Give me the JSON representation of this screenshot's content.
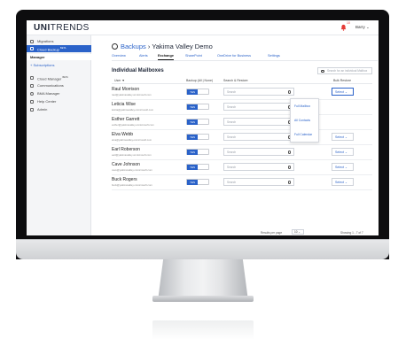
{
  "header": {
    "logo_bold": "UNI",
    "logo_rest": "TRENDS",
    "notification_count": "10",
    "user": "Barry ⌄"
  },
  "sidebar": {
    "items": [
      {
        "label": "Migrations",
        "icon": "migrations-icon"
      },
      {
        "label": "Cloud Backup",
        "beta": "BETA",
        "icon": "cloud-icon",
        "active": true
      }
    ],
    "manager_label": "Manager",
    "subscriptions_label": "+ Subscriptions",
    "lower_items": [
      {
        "label": "Cloud Manager",
        "beta": "BETA",
        "icon": "cloud-manager-icon"
      },
      {
        "label": "Communications",
        "icon": "communications-icon"
      },
      {
        "label": "BMA Manager",
        "icon": "bma-icon"
      },
      {
        "label": "Help Center",
        "icon": "help-icon"
      },
      {
        "label": "Admin",
        "icon": "admin-icon"
      }
    ]
  },
  "page": {
    "breadcrumb_link": "Backups",
    "breadcrumb_sep": " › ",
    "breadcrumb_current": "Yakima Valley Demo",
    "tabs": [
      "Overview",
      "Alerts",
      "Exchange",
      "SharePoint",
      "OneDrive for Business",
      "Settings"
    ],
    "active_tab": "Exchange",
    "section_title": "Individual Mailboxes",
    "search_placeholder": "Search for an individual Mailbox"
  },
  "table": {
    "headers": [
      "User ▼",
      "Backup (All | None)",
      "Search & Restore",
      "Bulk Restore"
    ],
    "rows": [
      {
        "name": "Raul Morrison",
        "email": "raul@yakimavalley.onmicrosoft.com",
        "backup": "YES",
        "search": "Search",
        "bulk": "Select ⌄"
      },
      {
        "name": "Leticia Wise",
        "email": "leticia@yakimavalley.onmicrosoft.com",
        "backup": "YES",
        "search": "Search",
        "bulk": ""
      },
      {
        "name": "Esther Garrett",
        "email": "esther@yakimavalley.onmicrosoft.com",
        "backup": "YES",
        "search": "Search",
        "bulk": ""
      },
      {
        "name": "Elva Webb",
        "email": "elva@yakimavalley.onmicrosoft.com",
        "backup": "YES",
        "search": "Search",
        "bulk": "Select ⌄"
      },
      {
        "name": "Earl Roberson",
        "email": "earl@yakimavalley.onmicrosoft.com",
        "backup": "YES",
        "search": "Search",
        "bulk": "Select ⌄"
      },
      {
        "name": "Cave Johnson",
        "email": "cave@yakimavalley.onmicrosoft.com",
        "backup": "YES",
        "search": "Search",
        "bulk": "Select ⌄"
      },
      {
        "name": "Buck Rogers",
        "email": "buck@yakimavalley.onmicrosoft.com",
        "backup": "YES",
        "search": "Search",
        "bulk": "Select ⌄"
      }
    ],
    "dropdown_options": [
      "Full Mailbox",
      "All Contacts",
      "Full Calendar"
    ],
    "results_per_page_label": "Results per page",
    "results_per_page_value": "10 ⌄",
    "showing": "Showing 1 - 7 of 7"
  },
  "colors": {
    "accent": "#2a62c9",
    "notification": "#e53935"
  }
}
